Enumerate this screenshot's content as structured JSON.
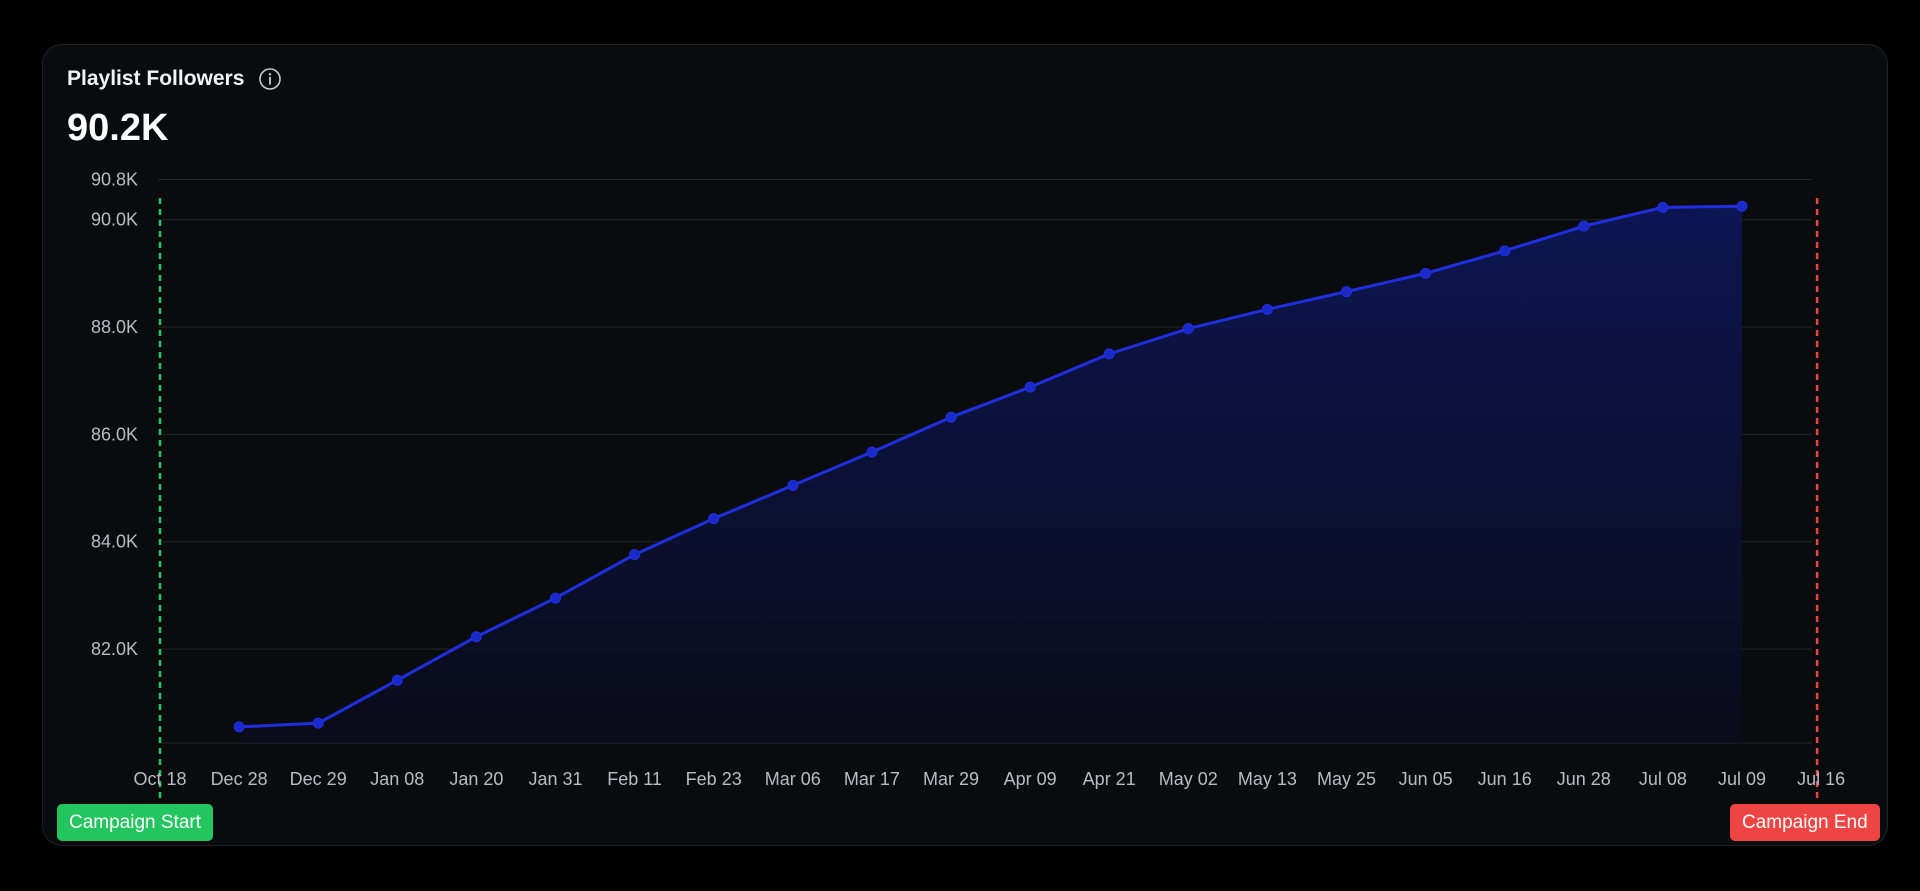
{
  "card": {
    "title": "Playlist Followers",
    "value": "90.2K",
    "info_icon": "info-circle-icon"
  },
  "campaign": {
    "start_label": "Campaign Start",
    "end_label": "Campaign End",
    "start_color": "#22c55e",
    "end_color": "#ef4444"
  },
  "colors": {
    "line": "#1f2fe0",
    "area_top": "#0c1656",
    "area_bottom": "#0a0c1c",
    "grid": "#23252a",
    "tick_text": "#b8bcc4"
  },
  "chart_data": {
    "type": "area",
    "title": "",
    "xlabel": "",
    "ylabel": "",
    "x_ticks": [
      "Oct 18",
      "Dec 28",
      "Dec 29",
      "Jan 08",
      "Jan 20",
      "Jan 31",
      "Feb 11",
      "Feb 23",
      "Mar 06",
      "Mar 17",
      "Mar 29",
      "Apr 09",
      "Apr 21",
      "May 02",
      "May 13",
      "May 25",
      "Jun 05",
      "Jun 16",
      "Jun 28",
      "Jul 08",
      "Jul 09",
      "Jul 16"
    ],
    "y_ticks": [
      "82.0K",
      "84.0K",
      "86.0K",
      "88.0K",
      "90.0K",
      "90.8K"
    ],
    "y_tick_values": [
      82000,
      84000,
      86000,
      88000,
      90000,
      90750
    ],
    "ylim": [
      80250,
      91075
    ],
    "grid": true,
    "series": [
      {
        "x": [
          "Dec 28",
          "Dec 29",
          "Jan 08",
          "Jan 20",
          "Jan 31",
          "Feb 11",
          "Feb 23",
          "Mar 06",
          "Mar 17",
          "Mar 29",
          "Apr 09",
          "Apr 21",
          "May 02",
          "May 13",
          "May 25",
          "Jun 05",
          "Jun 16",
          "Jun 28",
          "Jul 08",
          "Jul 09"
        ],
        "values": [
          80550,
          80620,
          81420,
          82230,
          82950,
          83760,
          84430,
          85050,
          85670,
          86320,
          86880,
          87500,
          87970,
          88330,
          88660,
          89000,
          89420,
          89880,
          90230,
          90250
        ]
      }
    ],
    "markers": {
      "campaign_start": "Oct 18",
      "campaign_end": "Jul 16"
    }
  }
}
